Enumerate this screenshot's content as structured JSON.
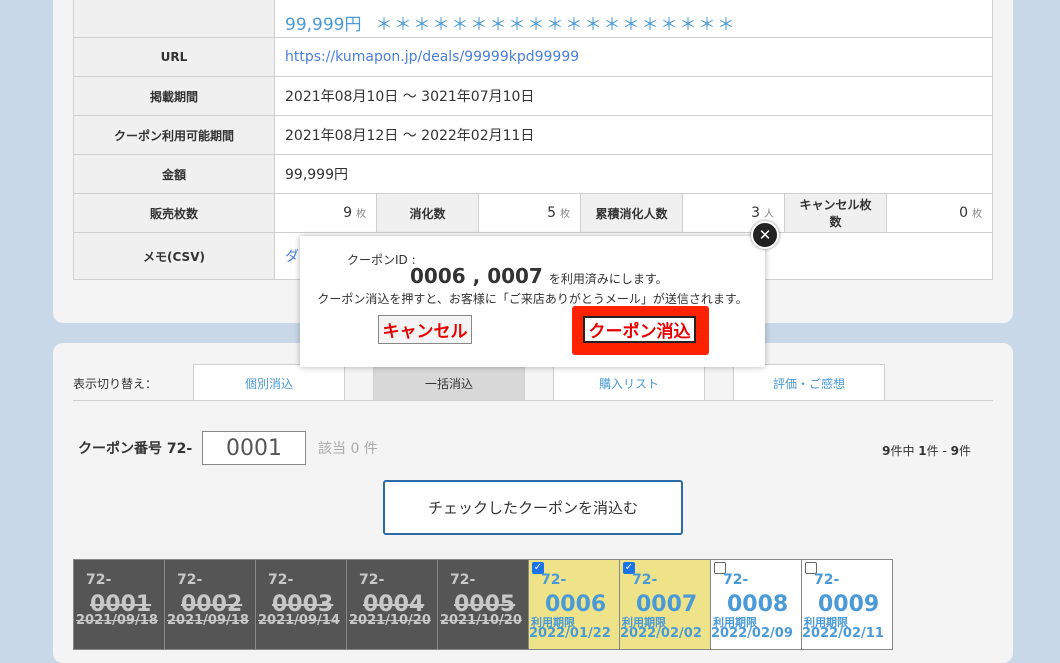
{
  "info": {
    "price": "99,999円",
    "stars": "＊＊＊＊＊＊＊＊＊＊＊＊＊＊＊＊＊＊＊",
    "url_label": "URL",
    "url_value": "https://kumapon.jp/deals/99999kpd99999",
    "period_label": "掲載期間",
    "period_value": "2021年08月10日 〜 3021年07月10日",
    "usable_label": "クーポン利用可能期間",
    "usable_value": "2021年08月12日 〜 2022年02月11日",
    "amount_label": "金額",
    "amount_value": "99,999円",
    "sold_label": "販売枚数",
    "sold_value": "9",
    "used_label": "消化数",
    "used_value": "5",
    "cumulative_label": "累積消化人数",
    "cumulative_value": "3",
    "cancel_label": "キャンセル枚数",
    "cancel_value": "0",
    "unit_sheets": "枚",
    "unit_people": "人",
    "memo_label": "メモ(CSV)",
    "memo_link": "ダ"
  },
  "view": {
    "switch_label": "表示切り替え：",
    "tabs": [
      "個別消込",
      "一括消込",
      "購入リスト",
      "評価・ご感想"
    ]
  },
  "search": {
    "coupon_no_label": "クーポン番号 72-",
    "coupon_no_value": "0001",
    "match": "該当 0 件",
    "count_total": "9",
    "count_mid": "件中",
    "count_from": "1",
    "count_sep": "件 -",
    "count_to": "9",
    "count_end": "件",
    "bulk_button": "チェックしたクーポンを消込む"
  },
  "coupons": [
    {
      "prefix": "72-",
      "no": "0001",
      "date": "2021/09/18",
      "state": "used"
    },
    {
      "prefix": "72-",
      "no": "0002",
      "date": "2021/09/18",
      "state": "used"
    },
    {
      "prefix": "72-",
      "no": "0003",
      "date": "2021/09/14",
      "state": "used"
    },
    {
      "prefix": "72-",
      "no": "0004",
      "date": "2021/10/20",
      "state": "used"
    },
    {
      "prefix": "72-",
      "no": "0005",
      "date": "2021/10/20",
      "state": "used"
    },
    {
      "prefix": "72-",
      "no": "0006",
      "limit": "利用期限",
      "date": "2022/01/22",
      "state": "selected",
      "checked": true
    },
    {
      "prefix": "72-",
      "no": "0007",
      "limit": "利用期限",
      "date": "2022/02/02",
      "state": "selected",
      "checked": true
    },
    {
      "prefix": "72-",
      "no": "0008",
      "limit": "利用期限",
      "date": "2022/02/09",
      "state": "free",
      "checked": false
    },
    {
      "prefix": "72-",
      "no": "0009",
      "limit": "利用期限",
      "date": "2022/02/11",
      "state": "free",
      "checked": false
    }
  ],
  "modal": {
    "id_label": "クーポンID :",
    "ids": "0006 , 0007",
    "ids_suffix": "を利用済みにします。",
    "note": "クーポン消込を押すと、お客様に「ご来店ありがとうメール」が送信されます。",
    "cancel": "キャンセル",
    "confirm": "クーポン消込",
    "close_glyph": "✕",
    "check_glyph": "✓"
  },
  "colors": {
    "accent": "#4a9ad8",
    "danger": "#e60000",
    "highlight": "#ff2200",
    "selected_bg": "#efe38a",
    "used_bg": "#555555"
  }
}
